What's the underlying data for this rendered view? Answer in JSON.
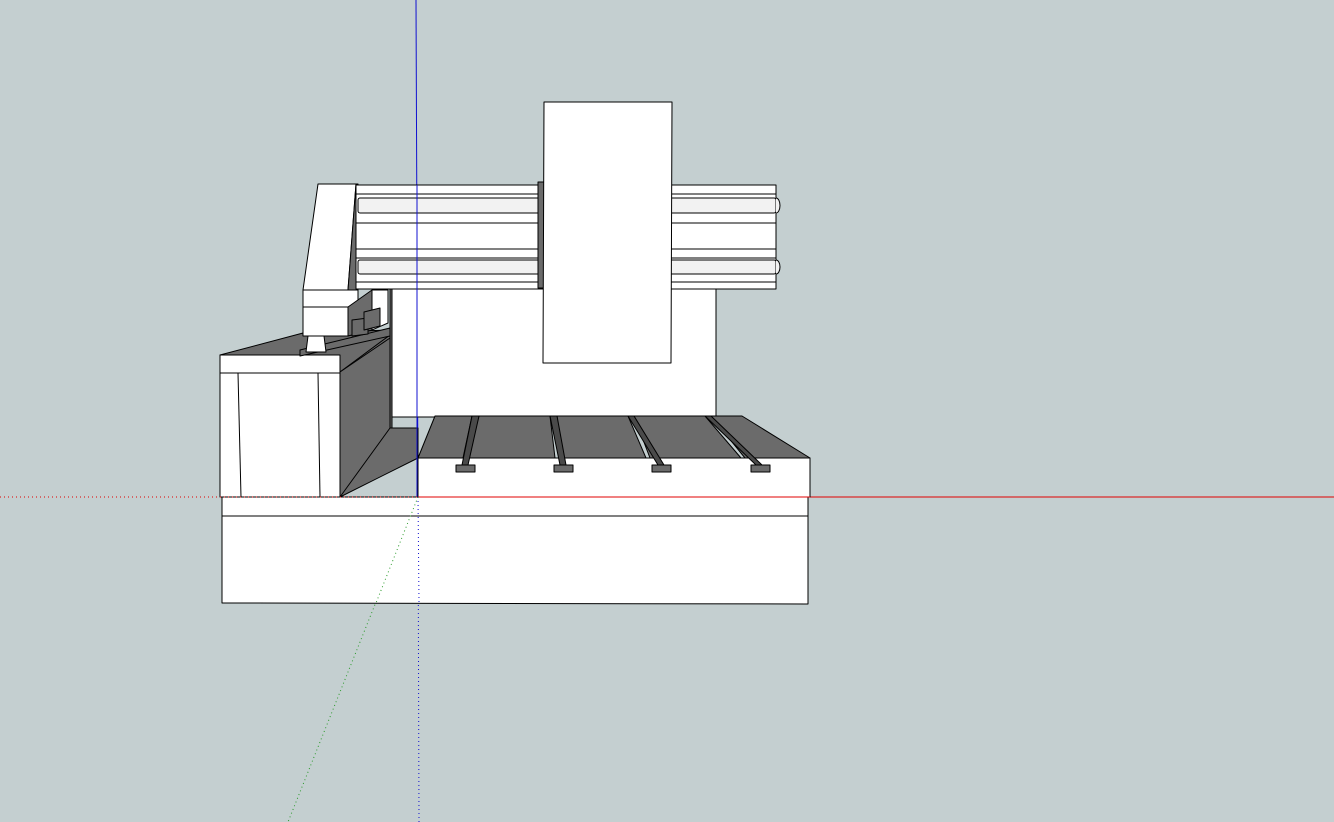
{
  "viewport": {
    "background": "#c4cfd0",
    "axis_colors": {
      "x_axis": "#e00000",
      "y_axis": "#2a9a2a",
      "z_axis": "#1010d0"
    }
  },
  "model": {
    "description_visible": false,
    "face_colors": {
      "front": "#ffffff",
      "shadow": "#6b6b6b",
      "slot": "#4a4a4a"
    }
  }
}
